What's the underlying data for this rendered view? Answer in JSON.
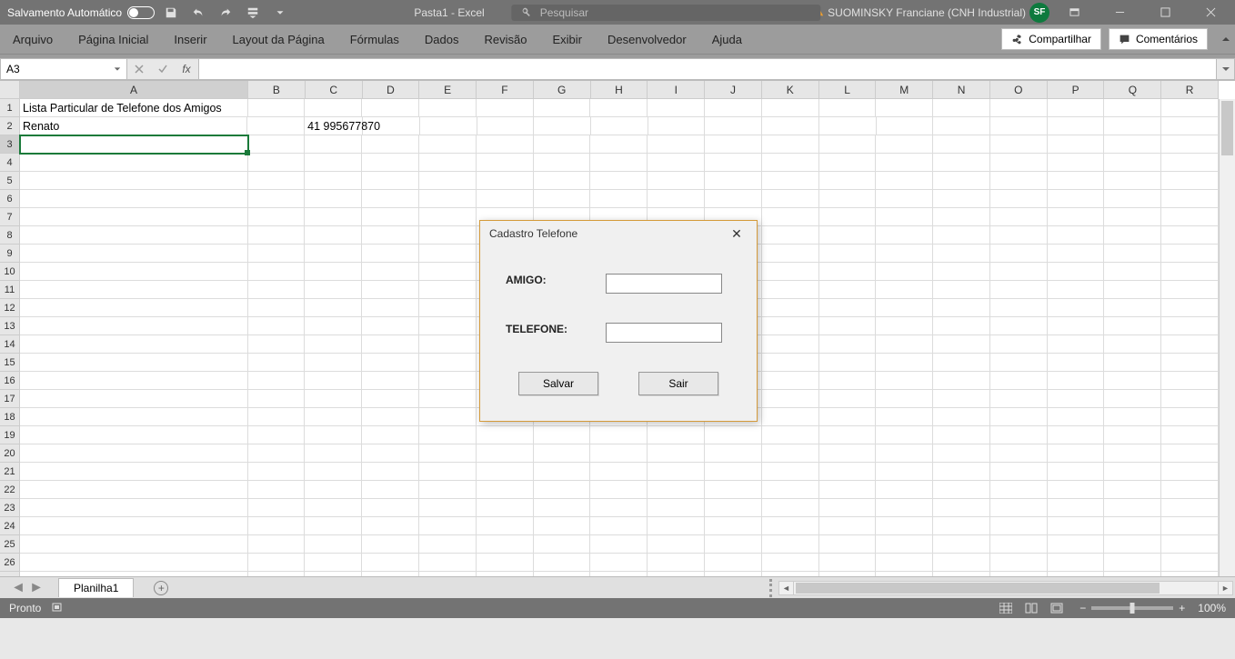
{
  "titlebar": {
    "autosave_label": "Salvamento Automático",
    "doc_title": "Pasta1 - Excel",
    "search_placeholder": "Pesquisar",
    "user_name": "SUOMINSKY Franciane (CNH Industrial)",
    "avatar_initials": "SF"
  },
  "ribbon": {
    "tabs": [
      "Arquivo",
      "Página Inicial",
      "Inserir",
      "Layout da Página",
      "Fórmulas",
      "Dados",
      "Revisão",
      "Exibir",
      "Desenvolvedor",
      "Ajuda"
    ],
    "share_label": "Compartilhar",
    "comments_label": "Comentários"
  },
  "formula_bar": {
    "name_box_value": "A3",
    "fx_label": "fx",
    "formula_value": ""
  },
  "grid": {
    "col_a_width": 256,
    "default_col_width": 64,
    "columns": [
      "A",
      "B",
      "C",
      "D",
      "E",
      "F",
      "G",
      "H",
      "I",
      "J",
      "K",
      "L",
      "M",
      "N",
      "O",
      "P",
      "Q",
      "R"
    ],
    "selected_col": "A",
    "selected_row": 3,
    "row_count": 27,
    "cells": {
      "A1": "Lista Particular de Telefone dos Amigos",
      "A2": "Renato",
      "C2": "41 995677870"
    }
  },
  "sheet_bar": {
    "active_tab": "Planilha1"
  },
  "status_bar": {
    "ready_label": "Pronto",
    "zoom_label": "100%"
  },
  "dialog": {
    "title": "Cadastro Telefone",
    "label_amigo": "AMIGO:",
    "label_telefone": "TELEFONE:",
    "input_amigo_value": "",
    "input_telefone_value": "",
    "btn_salvar": "Salvar",
    "btn_sair": "Sair"
  }
}
